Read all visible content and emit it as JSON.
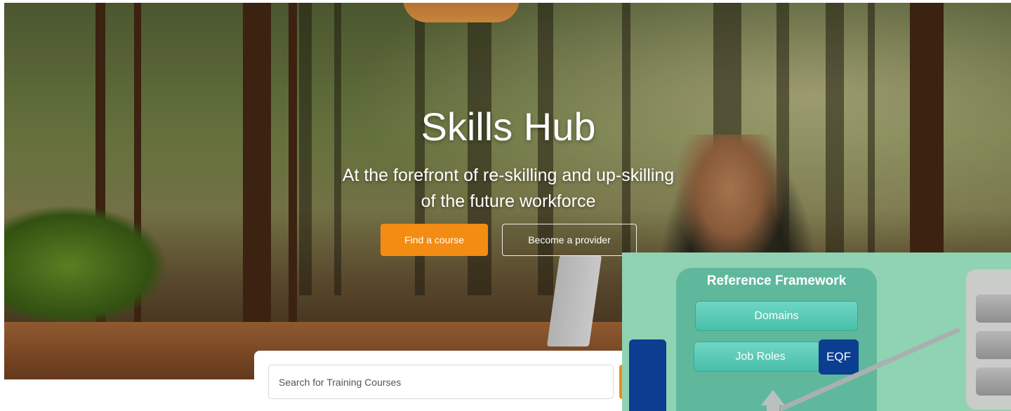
{
  "hero": {
    "title": "Skills Hub",
    "subtitle_line1": "At the forefront of re-skilling and up-skilling",
    "subtitle_line2": "of the future workforce",
    "primary_button": "Find a course",
    "secondary_button": "Become a provider"
  },
  "search": {
    "placeholder": "Search for Training Courses"
  },
  "reference_framework": {
    "title": "Reference Framework",
    "items": [
      "Domains",
      "Job Roles"
    ],
    "badge": "EQF"
  },
  "colors": {
    "accent": "#f28c13",
    "framework_blue": "#0b3d91",
    "framework_green": "#5fb89c"
  }
}
